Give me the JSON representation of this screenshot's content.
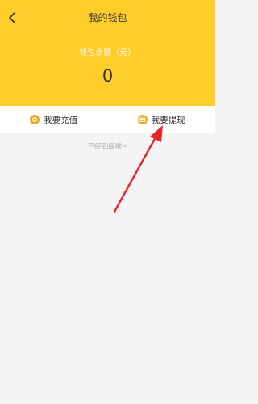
{
  "header": {
    "title": "我的钱包",
    "balance_label": "钱包余额（元）",
    "balance_value": "0"
  },
  "actions": {
    "recharge_label": "我要充值",
    "withdraw_label": "我要提现"
  },
  "footer_note": "已经到底啦~",
  "colors": {
    "header_bg": "#fdcd2c",
    "icon": "#f1a81c",
    "annotation_arrow": "#e8232a"
  },
  "icons": {
    "back": "chevron-left-icon",
    "recharge": "coin-icon",
    "withdraw": "wallet-icon"
  }
}
